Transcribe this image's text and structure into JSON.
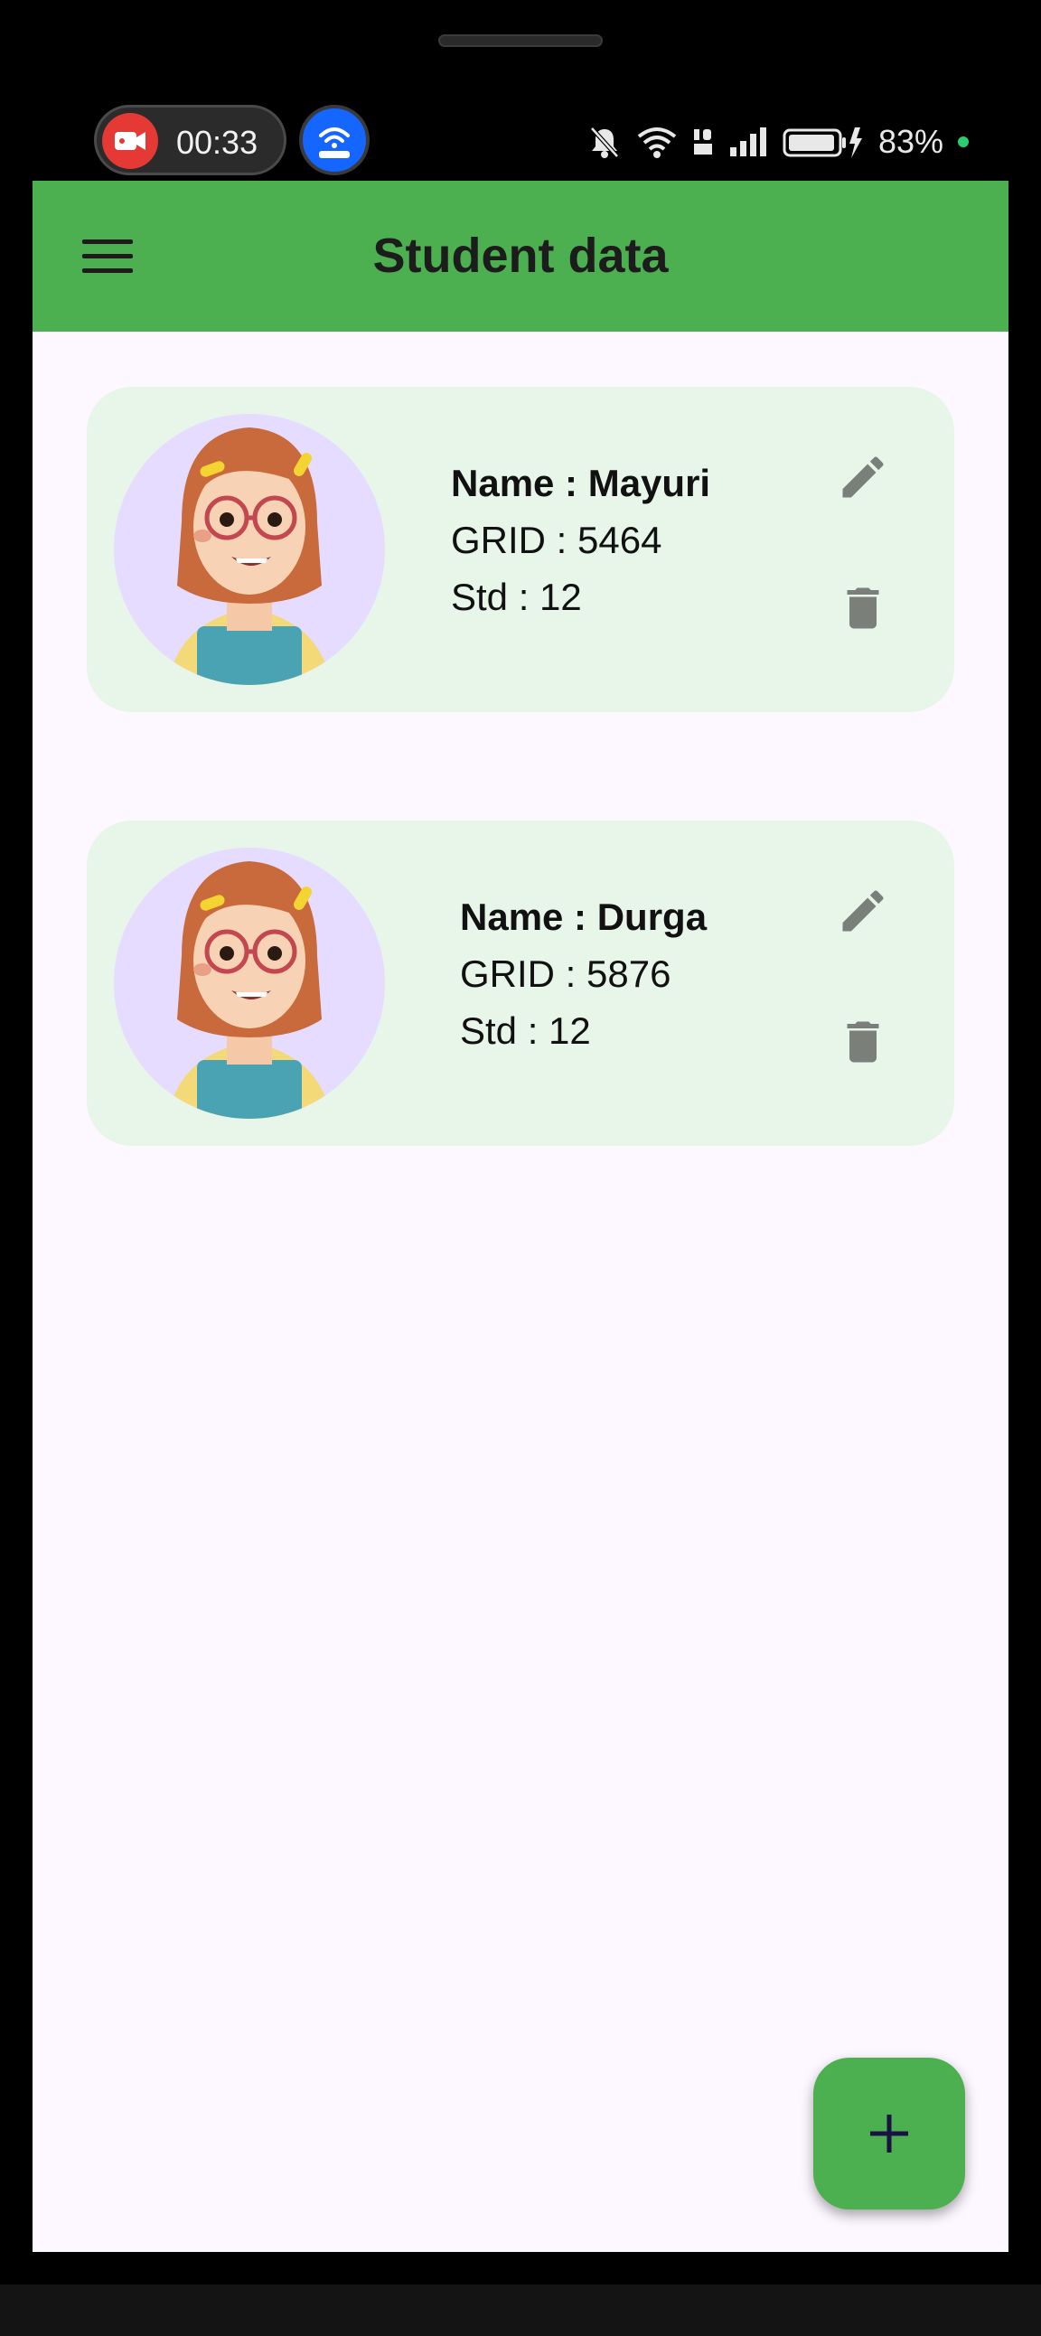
{
  "status_bar": {
    "recording_time": "00:33",
    "battery_percent": "83%"
  },
  "app_bar": {
    "title": "Student data"
  },
  "students": [
    {
      "name_label": "Name : Mayuri",
      "grid_label": "GRID : 5464",
      "std_label": "Std : 12"
    },
    {
      "name_label": "Name : Durga",
      "grid_label": "GRID : 5876",
      "std_label": "Std : 12"
    }
  ],
  "colors": {
    "app_bar": "#4caf50",
    "card_bg": "#e8f5e9",
    "screen_bg": "#fdf7ff",
    "icon_grey": "#7a7f7a",
    "fab": "#4caf50"
  },
  "icons": {
    "menu": "hamburger-menu-icon",
    "edit": "pencil-icon",
    "delete": "trash-icon",
    "add": "plus-icon"
  }
}
